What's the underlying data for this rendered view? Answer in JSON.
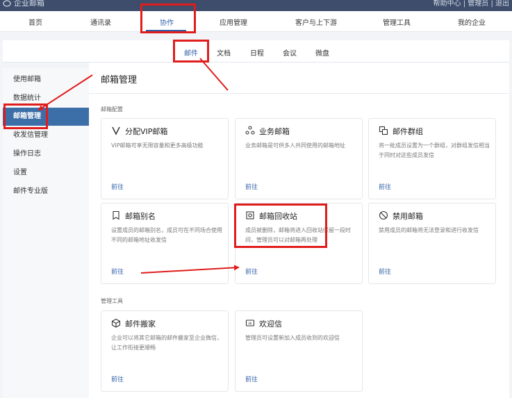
{
  "topbar": {
    "brand": "企业邮箱",
    "right_text": "帮助中心 | 管理员 | 退出"
  },
  "topnav": {
    "items": [
      {
        "label": "首页"
      },
      {
        "label": "通讯录"
      },
      {
        "label": "协作"
      },
      {
        "label": "应用管理"
      },
      {
        "label": "客户与上下游"
      },
      {
        "label": "管理工具"
      },
      {
        "label": "我的企业"
      }
    ],
    "active_index": 2
  },
  "subnav": {
    "items": [
      {
        "label": "邮件"
      },
      {
        "label": "文档"
      },
      {
        "label": "日程"
      },
      {
        "label": "会议"
      },
      {
        "label": "微盘"
      }
    ],
    "active_index": 0
  },
  "sidebar": {
    "items": [
      {
        "label": "使用邮箱"
      },
      {
        "label": "数据统计"
      },
      {
        "label": "邮箱管理"
      },
      {
        "label": "收发信管理"
      },
      {
        "label": "操作日志"
      },
      {
        "label": "设置"
      },
      {
        "label": "邮件专业版"
      }
    ],
    "active_index": 2
  },
  "main": {
    "title": "邮箱管理",
    "section1": "邮箱配置",
    "section2": "管理工具",
    "cards": [
      {
        "icon": "vip-v-icon",
        "title": "分配VIP邮箱",
        "desc": "VIP邮箱可享无限容量和更多高级功能",
        "link": "前往"
      },
      {
        "icon": "shared-mailbox-icon",
        "title": "业务邮箱",
        "desc": "业务邮箱是可供多人共同使用的邮箱地址",
        "link": "前往"
      },
      {
        "icon": "mail-group-icon",
        "title": "邮件群组",
        "desc": "将一批成员设置为一个群组，对群组发信相当于同时对这些成员发信",
        "link": "前往"
      },
      {
        "icon": "alias-tag-icon",
        "title": "邮箱别名",
        "desc": "设置成员的邮箱别名，成员可在不同场合使用不同的邮箱地址收发信",
        "link": "前往"
      },
      {
        "icon": "recycle-bin-icon",
        "title": "邮箱回收站",
        "desc": "成员被删除，邮箱将进入回收站保留一段时间，管理员可以对邮箱再处理",
        "link": "前往"
      },
      {
        "icon": "ban-icon",
        "title": "禁用邮箱",
        "desc": "禁用成员的邮箱将无法登录和进行收发信",
        "link": "前往"
      }
    ],
    "tool_cards": [
      {
        "icon": "mail-migrate-icon",
        "title": "邮件搬家",
        "desc": "企业可以将其它邮箱的邮件搬家至企业微信，让工作衔接更顺畅",
        "link": "前往"
      },
      {
        "icon": "welcome-letter-icon",
        "title": "欢迎信",
        "desc": "管理员可设置新加入成员收到的欢迎信",
        "link": "前往"
      }
    ]
  },
  "colors": {
    "accent": "#2f5fa8",
    "sidebar_active": "#3c6ea8",
    "topbar": "#3d4d6b",
    "annotation": "#e01c1c"
  }
}
